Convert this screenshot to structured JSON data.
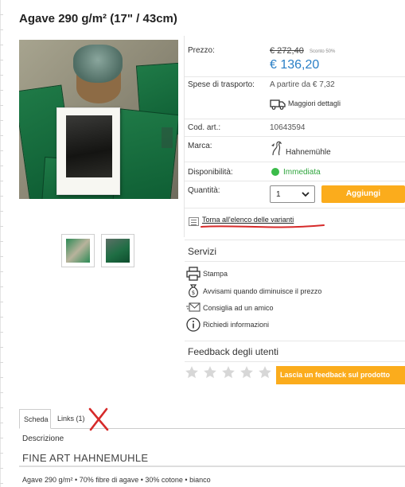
{
  "product": {
    "title": "Agave 290 g/m² (17\" / 43cm)"
  },
  "gallery": {
    "thumbnails": [
      "thumb-1",
      "thumb-2"
    ]
  },
  "info": {
    "price_label": "Prezzo:",
    "price_old": "€ 272,40",
    "discount": "Sconto 50%",
    "price_new": "€ 136,20",
    "shipping_label": "Spese di trasporto:",
    "shipping_value": "A partire da € 7,32",
    "shipping_details": "Maggiori dettagli",
    "sku_label": "Cod. art.:",
    "sku_value": "10643594",
    "brand_label": "Marca:",
    "brand_value": "Hahnemühle",
    "availability_label": "Disponibilità:",
    "availability_value": "Immediata",
    "quantity_label": "Quantità:",
    "quantity_value": "1",
    "add_button": "Aggiungi",
    "back_to_variants": "Torna all'elenco delle varianti"
  },
  "services": {
    "title": "Servizi",
    "items": [
      "Stampa",
      "Avvisami quando diminuisce il prezzo",
      "Consiglia ad un amico",
      "Richiedi informazioni"
    ]
  },
  "feedback": {
    "title": "Feedback degli utenti",
    "rating": 0,
    "max_rating": 5,
    "button": "Lascia un feedback sul prodotto"
  },
  "tabs": [
    "Scheda",
    "Links (1)"
  ],
  "description": {
    "heading": "Descrizione",
    "title": "FINE ART HAHNEMUHLE",
    "text": "Agave 290 g/m² • 70% fibre di agave • 30% cotone • bianco"
  },
  "colors": {
    "accent": "#fbac1c",
    "price": "#2a7fc6",
    "available": "#3bbb4a",
    "annotation": "#d62a2a"
  },
  "icons": [
    "truck-icon",
    "brand-logo-icon",
    "list-icon",
    "printer-icon",
    "money-bag-icon",
    "envelope-icon",
    "info-icon",
    "star-icon",
    "chevron-down-icon",
    "red-x-annotation"
  ]
}
